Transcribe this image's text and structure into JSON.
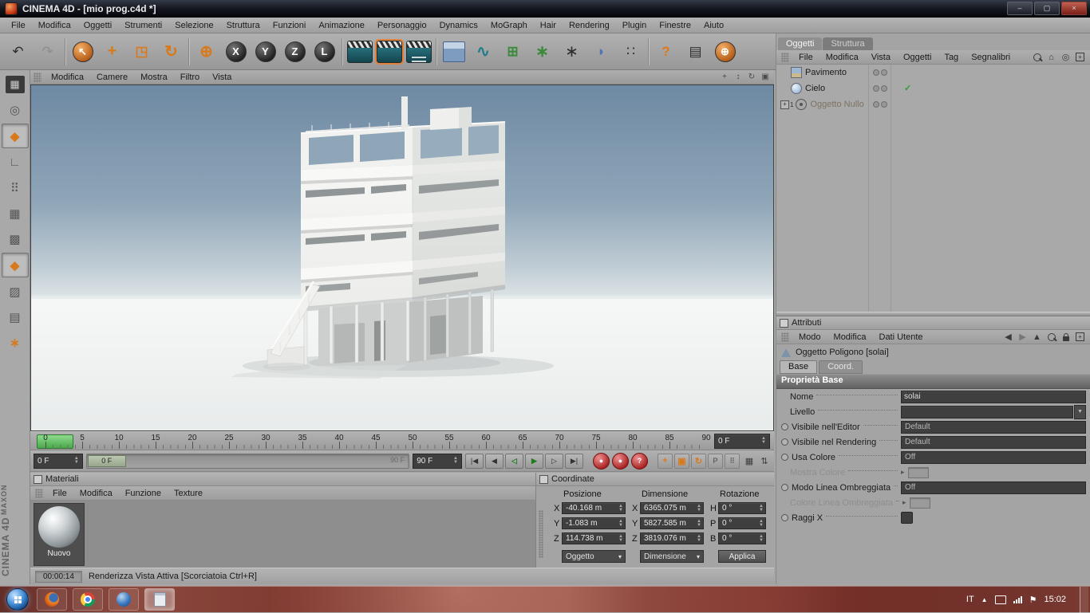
{
  "window": {
    "title": "CINEMA 4D - [mio prog.c4d *]",
    "minimize_glyph": "–",
    "maximize_glyph": "▢",
    "close_glyph": "×"
  },
  "menubar": [
    "File",
    "Modifica",
    "Oggetti",
    "Strumenti",
    "Selezione",
    "Struttura",
    "Funzioni",
    "Animazione",
    "Personaggio",
    "Dynamics",
    "MoGraph",
    "Hair",
    "Rendering",
    "Plugin",
    "Finestre",
    "Aiuto"
  ],
  "toolbar": [
    {
      "name": "undo-button",
      "glyph": "↶",
      "kind": "k-dark big"
    },
    {
      "name": "redo-button",
      "glyph": "↷",
      "kind": "k-disabled big"
    },
    {
      "kind": "sep"
    },
    {
      "name": "live-selection-button",
      "glyph": "↖",
      "kind": "orb orb-orange"
    },
    {
      "name": "move-tool-button",
      "glyph": "+",
      "kind": "k-orange xbig"
    },
    {
      "name": "scale-tool-button",
      "glyph": "◳",
      "kind": "k-orange big"
    },
    {
      "name": "rotate-tool-button",
      "glyph": "↻",
      "kind": "k-orange xbig"
    },
    {
      "kind": "sep"
    },
    {
      "name": "axis-tool-button",
      "glyph": "⊕",
      "kind": "k-orange xbig"
    },
    {
      "name": "lock-x-button",
      "glyph": "X",
      "kind": "orb orb-dark"
    },
    {
      "name": "lock-y-button",
      "glyph": "Y",
      "kind": "orb orb-dark"
    },
    {
      "name": "lock-z-button",
      "glyph": "Z",
      "kind": "orb orb-dark"
    },
    {
      "name": "coord-system-button",
      "glyph": "L",
      "kind": "orb orb-dark"
    },
    {
      "kind": "sep"
    },
    {
      "name": "render-view-button",
      "glyph": "",
      "kind": "clapper"
    },
    {
      "name": "render-picture-viewer-button",
      "glyph": "",
      "kind": "clapper active"
    },
    {
      "name": "render-settings-button",
      "glyph": "",
      "kind": "clapper settings"
    },
    {
      "kind": "sep"
    },
    {
      "name": "add-cube-button",
      "glyph": "",
      "kind": "cube"
    },
    {
      "name": "add-spline-button",
      "glyph": "∿",
      "kind": "k-teal xbig"
    },
    {
      "name": "add-generator-button",
      "glyph": "⊞",
      "kind": "k-green big"
    },
    {
      "name": "add-modeling-button",
      "glyph": "∗",
      "kind": "k-green xbig"
    },
    {
      "name": "mograph-button",
      "glyph": "∗",
      "kind": "k-dark xbig"
    },
    {
      "name": "add-deformer-button",
      "glyph": "◗",
      "kind": "k-blue big"
    },
    {
      "name": "simulation-button",
      "glyph": "∷",
      "kind": "k-dark big"
    },
    {
      "kind": "sep"
    },
    {
      "name": "help-button",
      "glyph": "?",
      "kind": "k-orange-bold big"
    },
    {
      "name": "content-browser-button",
      "glyph": "▤",
      "kind": "k-dark big"
    },
    {
      "name": "online-updater-button",
      "glyph": "⊕",
      "kind": "orb orb-orange"
    }
  ],
  "palette": [
    {
      "name": "make-editable-button",
      "glyph": "▦",
      "kind": "pi-dark"
    },
    {
      "name": "model-mode-button",
      "glyph": "◎",
      "kind": "pi-gray"
    },
    {
      "name": "object-axis-mode-button",
      "glyph": "◆",
      "kind": "pi-orange",
      "pressed": true
    },
    {
      "name": "texture-axis-mode-button",
      "glyph": "∟",
      "kind": "pi-gray"
    },
    {
      "name": "points-mode-button",
      "glyph": "⠿",
      "kind": "pi-gray"
    },
    {
      "name": "edges-mode-button",
      "glyph": "▦",
      "kind": "pi-gray"
    },
    {
      "name": "polygons-mode-button",
      "glyph": "▩",
      "kind": "pi-gray"
    },
    {
      "name": "polygon-tool-button",
      "glyph": "◆",
      "kind": "pi-orange",
      "pressed": true
    },
    {
      "name": "texture-mode-button",
      "glyph": "▨",
      "kind": "pi-gray"
    },
    {
      "name": "uv-mode-button",
      "glyph": "▤",
      "kind": "pi-gray"
    },
    {
      "name": "snap-settings-button",
      "glyph": "∗",
      "kind": "pi-orange"
    }
  ],
  "viewport": {
    "menu": [
      "Modifica",
      "Camere",
      "Mostra",
      "Filtro",
      "Vista"
    ],
    "icons": [
      {
        "name": "pan-view-icon",
        "glyph": "+"
      },
      {
        "name": "zoom-view-icon",
        "glyph": "↕"
      },
      {
        "name": "rotate-view-icon",
        "glyph": "↻"
      },
      {
        "name": "toggle-view-icon",
        "glyph": "▣"
      }
    ]
  },
  "timeline": {
    "ticks": [
      0,
      5,
      10,
      15,
      20,
      25,
      30,
      35,
      40,
      45,
      50,
      55,
      60,
      65,
      70,
      75,
      80,
      85,
      90
    ],
    "frame_field": "0 F"
  },
  "transport": {
    "start": "0 F",
    "marker": "0 F",
    "range_end": "90 F",
    "end": "90 F",
    "buttons": [
      {
        "name": "goto-start-button",
        "glyph": "|◀"
      },
      {
        "name": "prev-frame-button",
        "glyph": "◀"
      },
      {
        "name": "play-backward-button",
        "glyph": "◁",
        "kind": "green"
      },
      {
        "name": "play-button",
        "glyph": "▶",
        "kind": "green"
      },
      {
        "name": "next-frame-button",
        "glyph": "▷"
      },
      {
        "name": "goto-end-button",
        "glyph": "▶|"
      }
    ],
    "record": [
      {
        "name": "record-keyframe-button",
        "glyph": "●"
      },
      {
        "name": "autokey-button",
        "glyph": "●"
      },
      {
        "name": "record-options-button",
        "glyph": "?"
      }
    ],
    "channels": [
      {
        "name": "record-position-button",
        "glyph": "+",
        "kind": "orange"
      },
      {
        "name": "record-scale-button",
        "glyph": "▣",
        "kind": "orange"
      },
      {
        "name": "record-rotation-button",
        "glyph": "↻",
        "kind": "orange"
      },
      {
        "name": "record-parameter-button",
        "glyph": "P",
        "kind": "gray"
      },
      {
        "name": "record-pla-button",
        "glyph": "⠿",
        "kind": "gray"
      }
    ],
    "right_icons": [
      {
        "name": "timeline-layout-icon",
        "glyph": "▦"
      },
      {
        "name": "timeline-expand-icon",
        "glyph": "⇅"
      }
    ]
  },
  "materials": {
    "title": "Materiali",
    "menu": [
      "File",
      "Modifica",
      "Funzione",
      "Texture"
    ],
    "first_material": "Nuovo"
  },
  "coordinates": {
    "title": "Coordinate",
    "headers": [
      "Posizione",
      "Dimensione",
      "Rotazione"
    ],
    "rows": [
      {
        "pl": "X",
        "pv": "-40.168 m",
        "dl": "X",
        "dv": "6365.075 m",
        "rl": "H",
        "rv": "0 °"
      },
      {
        "pl": "Y",
        "pv": "-1.083 m",
        "dl": "Y",
        "dv": "5827.585 m",
        "rl": "P",
        "rv": "0 °"
      },
      {
        "pl": "Z",
        "pv": "114.738 m",
        "dl": "Z",
        "dv": "3819.076 m",
        "rl": "B",
        "rv": "0 °"
      }
    ],
    "object_mode": "Oggetto",
    "dimension_mode": "Dimensione",
    "apply": "Applica"
  },
  "statusbar": {
    "time": "00:00:14",
    "message": "Renderizza Vista Attiva [Scorciatoia Ctrl+R]"
  },
  "objects_panel": {
    "tabs": [
      {
        "label": "Oggetti"
      },
      {
        "label": "Struttura"
      }
    ],
    "menu": [
      "File",
      "Modifica",
      "Vista",
      "Oggetti",
      "Tag",
      "Segnalibri"
    ],
    "items": [
      {
        "name": "Pavimento",
        "icon": "floor"
      },
      {
        "name": "Cielo",
        "icon": "sky",
        "check": true
      },
      {
        "name": "Oggetto Nullo",
        "icon": "null",
        "expand": true,
        "badge": "1",
        "muted": true
      }
    ]
  },
  "attributes_panel": {
    "title": "Attributi",
    "menu": [
      "Modo",
      "Modifica",
      "Dati Utente"
    ],
    "object": "Oggetto Poligono [solai]",
    "tabs": [
      {
        "label": "Base"
      },
      {
        "label": "Coord."
      }
    ],
    "section": "Proprietà Base",
    "rows": [
      {
        "label": "Nome",
        "type": "input",
        "value": "solai"
      },
      {
        "label": "Livello",
        "type": "input-arrow",
        "value": ""
      },
      {
        "label": "Visibile nell'Editor",
        "type": "dropdown",
        "value": "Default",
        "dot": true
      },
      {
        "label": "Visibile nel Rendering",
        "type": "dropdown",
        "value": "Default",
        "dot": true
      },
      {
        "label": "Usa Colore",
        "type": "dropdown",
        "value": "Off",
        "dot": true
      },
      {
        "label": "Mostra Colore",
        "type": "swatch",
        "disabled": true
      },
      {
        "label": "Modo Linea Ombreggiata",
        "type": "dropdown",
        "value": "Off",
        "dot": true
      },
      {
        "label": "Colore Linea Ombreggiata",
        "type": "swatch",
        "disabled": true
      },
      {
        "label": "Raggi X",
        "type": "checkbox",
        "dot": true
      }
    ]
  },
  "branding": {
    "line1": "MAXON",
    "line2": "CINEMA 4D"
  },
  "taskbar": {
    "language": "IT",
    "time": "15:02"
  }
}
